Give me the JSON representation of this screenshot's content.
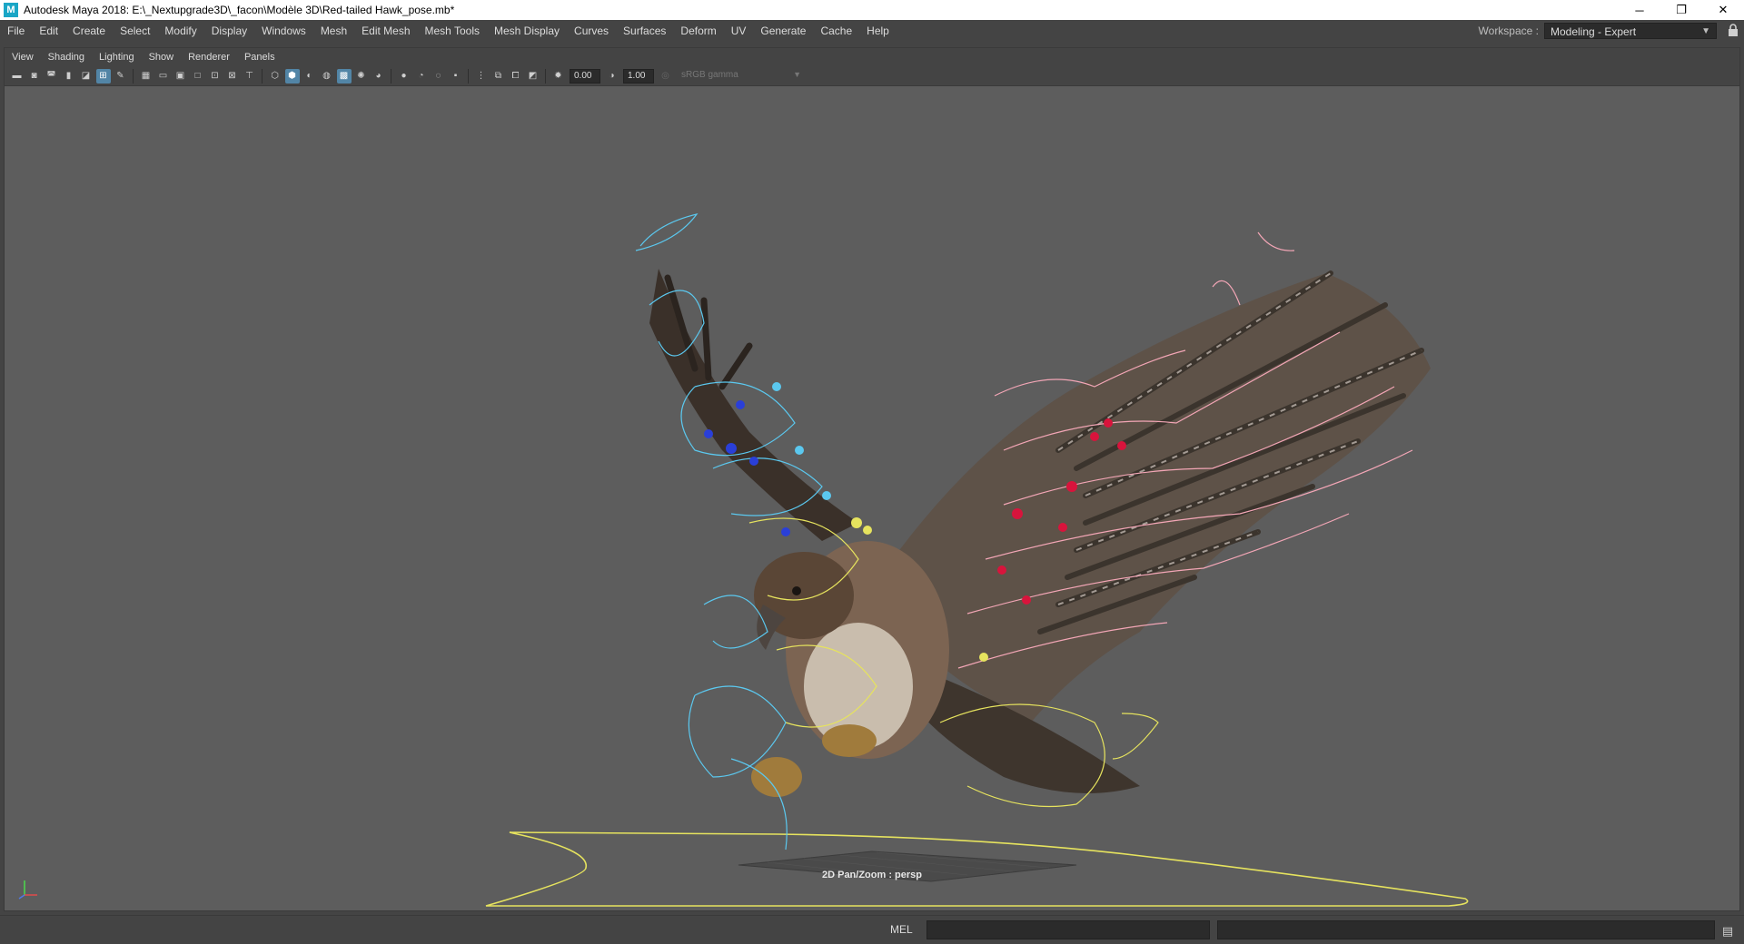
{
  "window": {
    "title": "Autodesk Maya 2018: E:\\_Nextupgrade3D\\_facon\\Modèle 3D\\Red-tailed Hawk_pose.mb*",
    "app_icon": "M",
    "minimize": "─",
    "restore": "❐",
    "close": "✕"
  },
  "main_menu": [
    "File",
    "Edit",
    "Create",
    "Select",
    "Modify",
    "Display",
    "Windows",
    "Mesh",
    "Edit Mesh",
    "Mesh Tools",
    "Mesh Display",
    "Curves",
    "Surfaces",
    "Deform",
    "UV",
    "Generate",
    "Cache",
    "Help"
  ],
  "workspace": {
    "label": "Workspace :",
    "value": "Modeling - Expert",
    "lock_icon": "lock-icon"
  },
  "panel_menu": [
    "View",
    "Shading",
    "Lighting",
    "Show",
    "Renderer",
    "Panels"
  ],
  "panel_toolbar": {
    "exposure_value": "0.00",
    "gamma_value": "1.00",
    "color_space": "sRGB gamma"
  },
  "viewport": {
    "camera_label": "2D Pan/Zoom : persp",
    "background": "#5d5d5d"
  },
  "colors": {
    "ui_dark": "#444444",
    "active_icon": "#5285a6",
    "rig_left": "#5bc8ef",
    "rig_right": "#f3a6b6",
    "rig_center": "#e6e35e",
    "left_controls": "#2a3fd8",
    "right_controls": "#d8143c"
  },
  "command_line": {
    "mode": "MEL"
  }
}
